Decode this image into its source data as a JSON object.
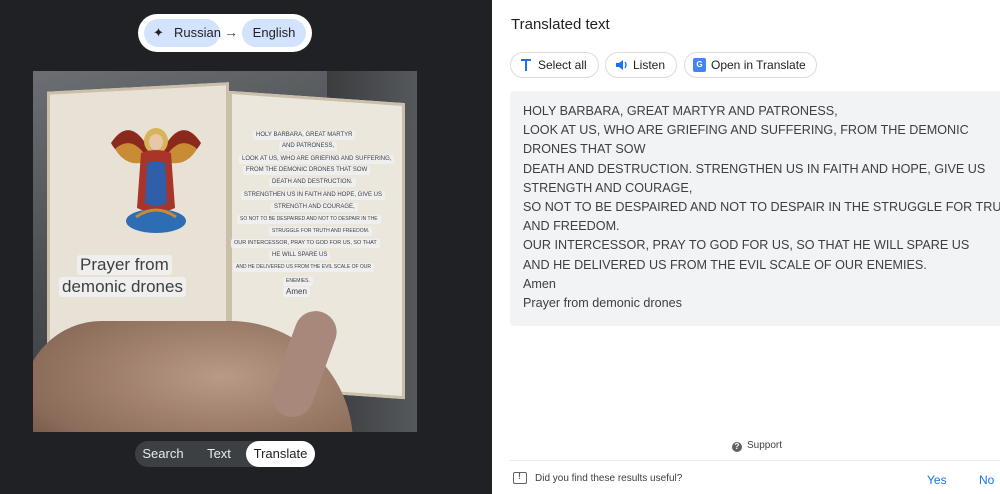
{
  "lens": {
    "source_lang": "Russian",
    "target_lang": "English",
    "modes": [
      "Search",
      "Text",
      "Translate"
    ],
    "active_mode": "Translate"
  },
  "image_overlay": {
    "lines": [
      "HOLY BARBARA, GREAT MARTYR",
      "AND PATRONESS,",
      "LOOK AT US, WHO ARE GRIEFING AND SUFFERING,",
      "FROM THE DEMONIC DRONES THAT SOW",
      "DEATH AND DESTRUCTION.",
      "STRENGTHEN US IN FAITH AND HOPE, GIVE US",
      "STRENGTH AND COURAGE,",
      "SO NOT TO BE DESPAIRED AND NOT TO DESPAIR IN THE",
      "STRUGGLE FOR TRUTH AND FREEDOM.",
      "OUR INTERCESSOR, PRAY TO GOD FOR US, SO THAT",
      "HE WILL SPARE US",
      "AND HE DELIVERED US FROM THE EVIL SCALE OF OUR",
      "ENEMIES.",
      "Amen"
    ],
    "caption_1": "Prayer from",
    "caption_2": "demonic drones"
  },
  "panel": {
    "title": "Translated text",
    "select_all": "Select all",
    "listen": "Listen",
    "open_in_translate": "Open in Translate",
    "translated_lines": [
      "HOLY BARBARA, GREAT MARTYR AND PATRONESS,",
      "LOOK AT US, WHO ARE GRIEFING AND SUFFERING, FROM THE DEMONIC",
      "DRONES THAT SOW",
      "DEATH AND DESTRUCTION. STRENGTHEN US IN FAITH AND HOPE, GIVE US",
      "STRENGTH AND COURAGE,",
      "SO NOT TO BE DESPAIRED AND NOT TO DESPAIR IN THE STRUGGLE FOR TRUTH",
      "AND FREEDOM.",
      "OUR INTERCESSOR, PRAY TO GOD FOR US, SO THAT HE WILL SPARE US",
      "AND HE DELIVERED US FROM THE EVIL SCALE OF OUR ENEMIES.",
      "Amen",
      "Prayer from demonic drones"
    ]
  },
  "footer": {
    "support": "Support",
    "feedback_question": "Did you find these results useful?",
    "yes": "Yes",
    "no": "No"
  },
  "colors": {
    "left_bg": "#202124",
    "chip_bg": "#d3e3fd",
    "link_blue": "#1a73e8",
    "text_box_bg": "#f1f3f4"
  }
}
